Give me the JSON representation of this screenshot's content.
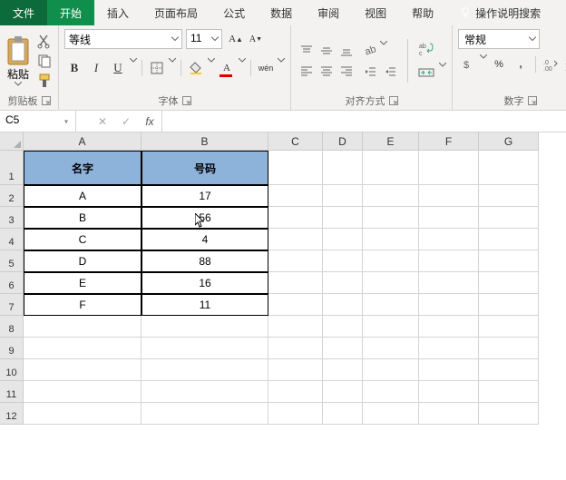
{
  "menu": {
    "file": "文件",
    "home": "开始",
    "insert": "插入",
    "layout": "页面布局",
    "formulas": "公式",
    "data": "数据",
    "review": "审阅",
    "view": "视图",
    "help": "帮助",
    "tellme": "操作说明搜索"
  },
  "ribbon": {
    "paste": "粘贴",
    "clipboard_label": "剪贴板",
    "font_name": "等线",
    "font_size": "11",
    "font_label": "字体",
    "align_label": "对齐方式",
    "wen": "wén",
    "number_format": "常规",
    "number_label": "数字"
  },
  "namebox": "C5",
  "columns": [
    "A",
    "B",
    "C",
    "D",
    "E",
    "F",
    "G"
  ],
  "row_numbers": [
    "1",
    "2",
    "3",
    "4",
    "5",
    "6",
    "7",
    "8",
    "9",
    "10",
    "11",
    "12"
  ],
  "table": {
    "headers": {
      "name": "名字",
      "num": "号码"
    },
    "rows": [
      {
        "name": "A",
        "num": "17"
      },
      {
        "name": "B",
        "num": "56"
      },
      {
        "name": "C",
        "num": "4"
      },
      {
        "name": "D",
        "num": "88"
      },
      {
        "name": "E",
        "num": "16"
      },
      {
        "name": "F",
        "num": "11"
      }
    ]
  },
  "chart_data": {
    "type": "table",
    "title": "",
    "columns": [
      "名字",
      "号码"
    ],
    "rows": [
      [
        "A",
        17
      ],
      [
        "B",
        56
      ],
      [
        "C",
        4
      ],
      [
        "D",
        88
      ],
      [
        "E",
        16
      ],
      [
        "F",
        11
      ]
    ]
  }
}
